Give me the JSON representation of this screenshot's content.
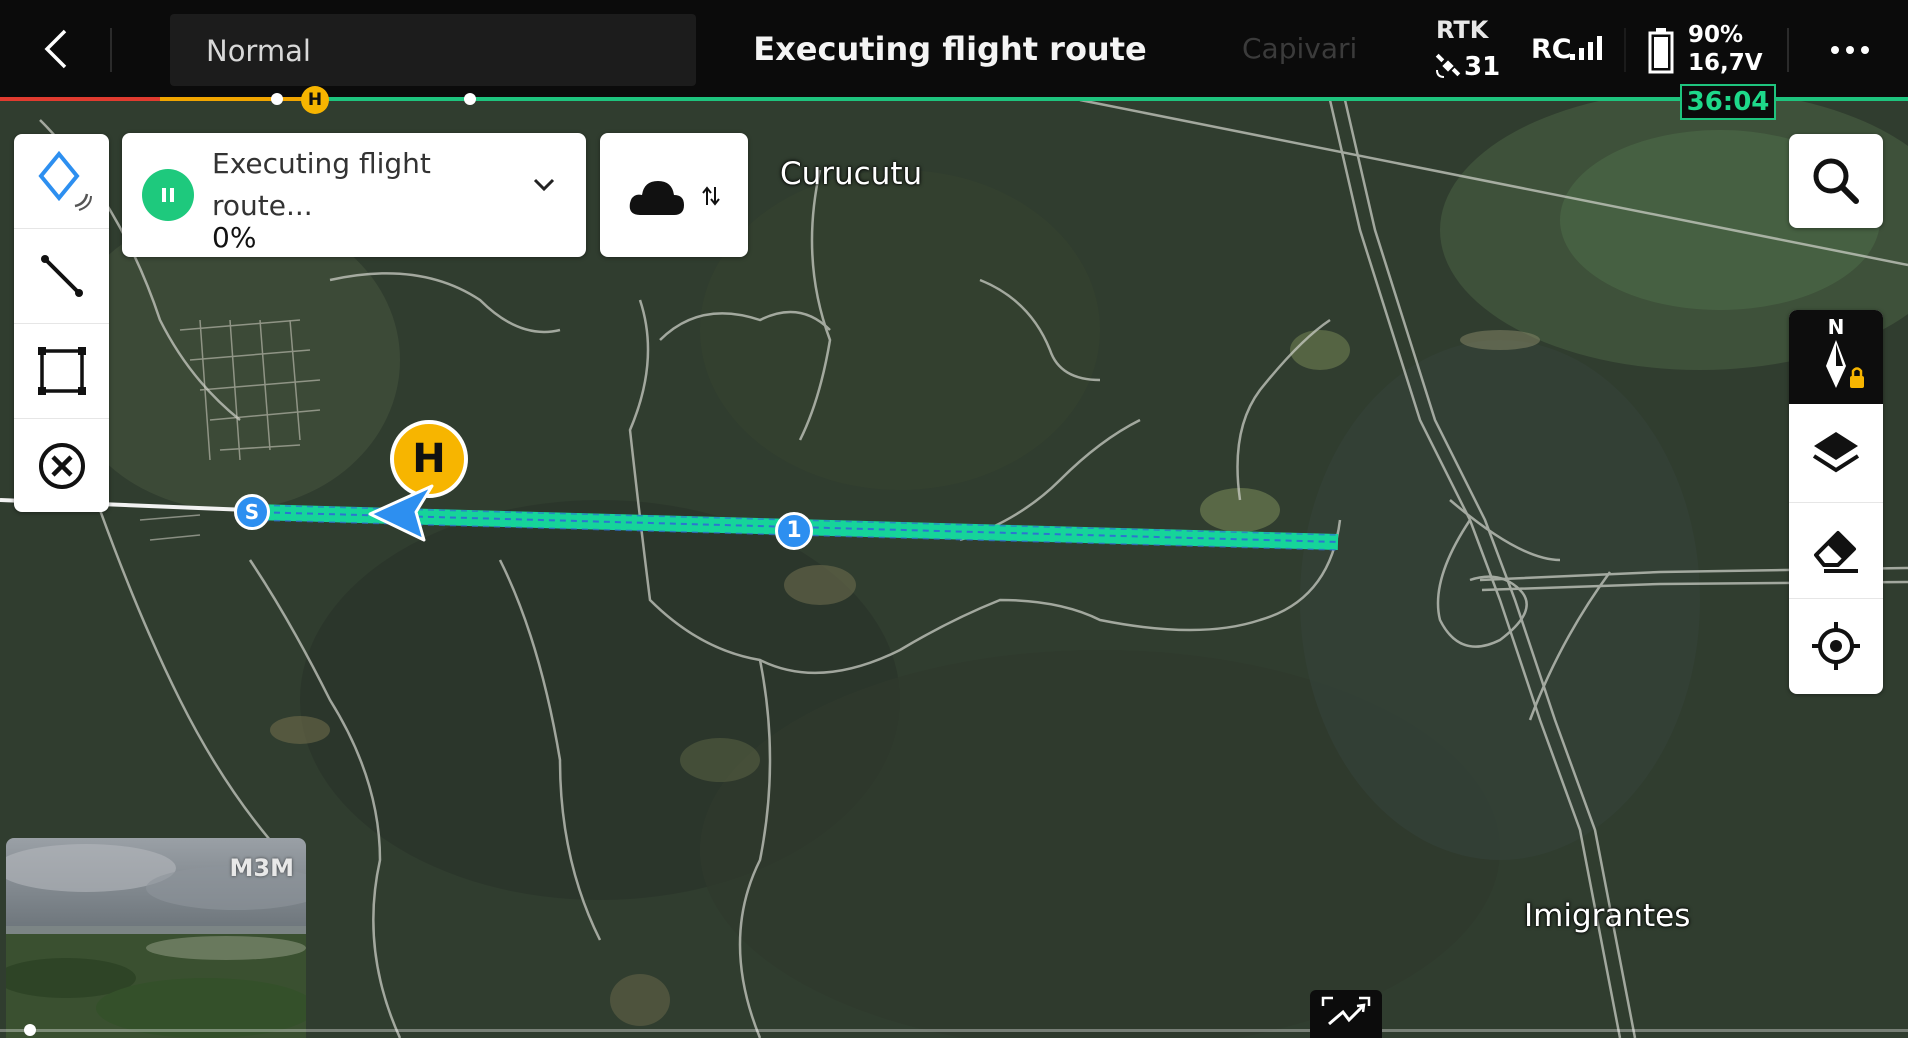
{
  "topbar": {
    "mode_label": "Normal",
    "title": "Executing flight route",
    "ghost_place": "Capivari",
    "rtk_label": "RTK",
    "rtk_satellites": "31",
    "rc_label": "RC",
    "battery_percent": "90%",
    "battery_voltage": "16,7V",
    "timer": "36:04"
  },
  "progress": {
    "home_marker": "H",
    "colors": {
      "done": "#e03b2f",
      "current": "#f0a500",
      "remaining": "#1ec47e"
    }
  },
  "toolbar": {
    "tools": [
      "waypoint-tool",
      "line-tool",
      "area-tool",
      "clear-tool"
    ]
  },
  "status_card": {
    "status_text": "Executing flight route...",
    "percent": "0%"
  },
  "map": {
    "places": {
      "curucutu": "Curucutu",
      "imigrantes": "Imigrantes"
    },
    "home_marker": "H",
    "start_marker": "S",
    "waypoint_1": "1",
    "route_color": "#16d49a"
  },
  "preview": {
    "camera_label": "M3M"
  },
  "colors": {
    "accent_green": "#1ec97d",
    "home_yellow": "#f7b500",
    "aircraft_blue": "#2d8ff0"
  }
}
